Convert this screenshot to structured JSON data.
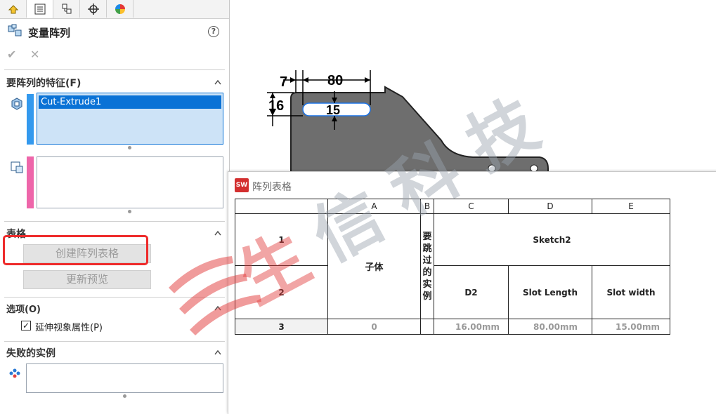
{
  "property_manager": {
    "title": "变量阵列",
    "tabs": [
      "feature-manager",
      "property-manager",
      "configuration-manager",
      "dim-xpert",
      "display-manager"
    ],
    "features_section": {
      "title": "要阵列的特征(F)",
      "items": [
        "Cut-Extrude1"
      ],
      "strip_color": "#3399ee"
    },
    "faces_strip_color": "#ee66aa",
    "table_section": {
      "title": "表格",
      "create_button": "创建阵列表格",
      "update_button": "更新预览"
    },
    "options_section": {
      "title": "选项(O)",
      "checkbox_label": "延伸视象属性(P)",
      "checked": true
    },
    "failed_section": {
      "title": "失败的实例"
    }
  },
  "drawing": {
    "dims": [
      "7",
      "80",
      "16",
      "15"
    ]
  },
  "watermark": {
    "text": [
      "生",
      "信",
      "科",
      "技"
    ]
  },
  "table_window": {
    "title": "阵列表格",
    "logo": "SW",
    "columns": [
      "A",
      "B",
      "C",
      "D",
      "E"
    ],
    "row_headers": [
      "1",
      "2",
      "3"
    ],
    "cells": {
      "a_header": "子体",
      "b_header": [
        "要",
        "跳",
        "过",
        "的",
        "实",
        "例"
      ],
      "sketch": "Sketch2",
      "d2": "D2",
      "slot_length": "Slot Length",
      "slot_width": "Slot width"
    },
    "data_row": [
      "0",
      "",
      "16.00mm",
      "80.00mm",
      "15.00mm"
    ]
  },
  "colors": {
    "highlight_red": "#ee2b2b",
    "selection_blue": "#0a72d6",
    "watermark_red": "#e23a3a",
    "watermark_gray": "#9aa4ae"
  }
}
